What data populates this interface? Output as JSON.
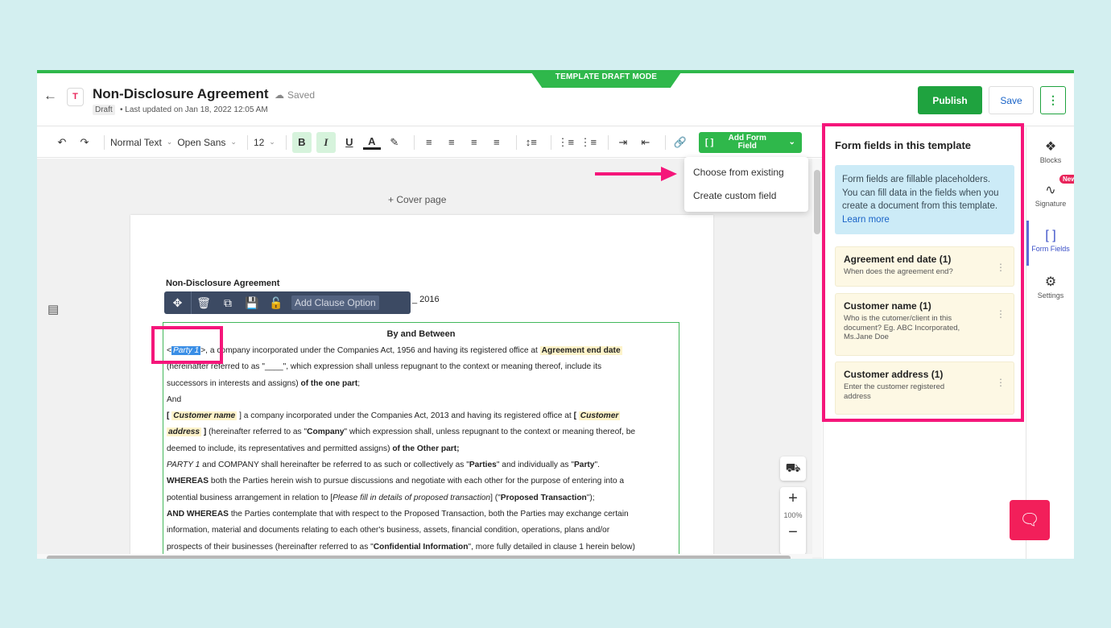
{
  "header": {
    "mode_banner": "TEMPLATE DRAFT MODE",
    "doc_icon_letter": "T",
    "title": "Non-Disclosure Agreement",
    "saved": "Saved",
    "draft_badge": "Draft",
    "updated": "• Last updated on Jan 18, 2022 12:05 AM",
    "publish": "Publish",
    "save": "Save",
    "more": "⋮"
  },
  "toolbar": {
    "style": "Normal Text",
    "font": "Open Sans",
    "size": "12",
    "add_form_field": "Add Form Field"
  },
  "dropdown": {
    "options": [
      "Choose from existing",
      "Create custom field"
    ]
  },
  "editor": {
    "cover_page": "+ Cover page",
    "doc_heading": "Non-Disclosure Agreement",
    "year_text": "_ 2016",
    "clause_add_option": "Add Clause Option",
    "by_between": "By and Between",
    "zoom_level": "100%"
  },
  "doc": {
    "l1_party": "Party 1",
    "l1_rest": ">, a company incorporated under the Companies Act, 1956 and having its registered office at ",
    "l1_field": "Agreement end date",
    "l2": "(hereinafter referred to as \"____\", which expression shall unless repugnant to the context or meaning thereof, include its",
    "l3_a": "successors in interests and assigns) ",
    "l3_b": "of the one part",
    "l3_c": ";",
    "l4": "And",
    "l5_a": "[ ",
    "l5_field": "Customer name",
    "l5_b": " ] a company incorporated under the Companies Act, 2013 and having its registered office at ",
    "l5_c": "[ ",
    "l5_field2": "Customer",
    "l6_field": "address",
    "l6_a": " ] ",
    "l6_b": "(hereinafter referred to as \"",
    "l6_c": "Company",
    "l6_d": "\" which expression shall, unless repugnant to the context or meaning thereof, be",
    "l7_a": "deemed to include, its representatives and permitted assigns) ",
    "l7_b": "of the Other part;",
    "l8_a": "PARTY 1",
    "l8_b": " and COMPANY shall hereinafter be referred to as such or collectively as \"",
    "l8_c": "Parties",
    "l8_d": "\" and individually as \"",
    "l8_e": "Party",
    "l8_f": "\".",
    "l9_a": "WHEREAS",
    "l9_b": " both the Parties herein wish to pursue discussions and negotiate with each other for the purpose of entering into a",
    "l10_a": "potential business arrangement in relation to [",
    "l10_b": "Please fill in details of proposed transaction",
    "l10_c": "] (\"",
    "l10_d": "Proposed Transaction",
    "l10_e": "\");",
    "l11_a": "AND WHEREAS",
    "l11_b": " the Parties contemplate that with respect to the Proposed Transaction, both the Parties may exchange certain",
    "l12": "information, material and documents relating to each other's business, assets, financial condition, operations, plans and/or",
    "l13_a": "prospects of their businesses (hereinafter referred to as \"",
    "l13_b": "Confidential Information",
    "l13_c": "\", more fully detailed in clause 1 herein below)"
  },
  "fields_panel": {
    "title": "Form fields in this template",
    "info": "Form fields are fillable placeholders. You can fill data in the fields when you create a document from this template.",
    "learn_more": "Learn more",
    "fields": [
      {
        "name": "Agreement end date (1)",
        "desc": "When does the agreement end?"
      },
      {
        "name": "Customer name (1)",
        "desc": "Who is the cutomer/client in this document? Eg. ABC Incorporated, Ms.Jane Doe"
      },
      {
        "name": "Customer address (1)",
        "desc": "Enter the customer registered address"
      }
    ]
  },
  "rail": {
    "blocks": "Blocks",
    "signature": "Signature",
    "new_badge": "New",
    "form_fields": "Form Fields",
    "settings": "Settings"
  },
  "colors": {
    "accent_green": "#2fb84b",
    "highlight_pink": "#f5167a",
    "field_bg": "#fdf3c9"
  }
}
